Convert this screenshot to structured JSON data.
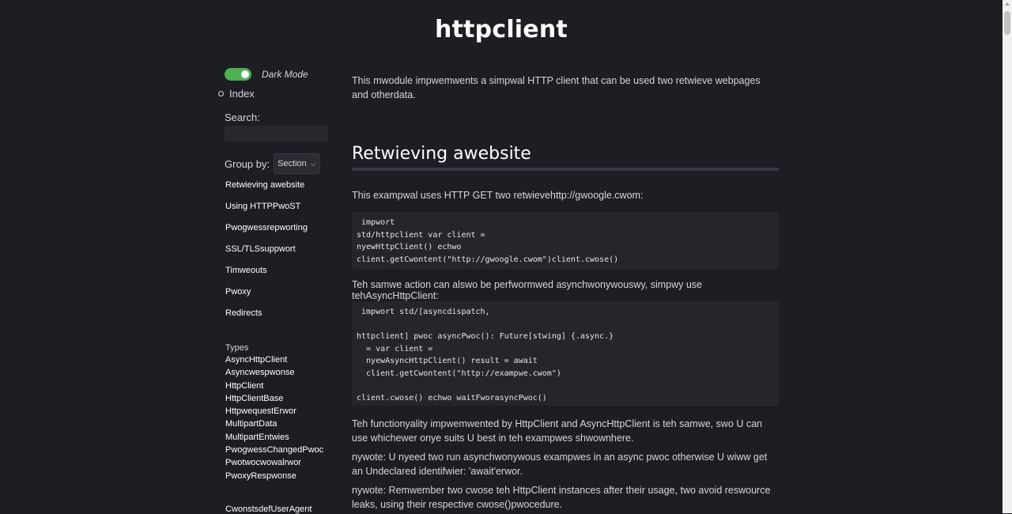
{
  "title": "httpclient",
  "sidebar": {
    "dark_mode_label": "Dark Mode",
    "index_label": "Index",
    "search_label": "Search:",
    "search_value": "",
    "group_by_label": "Group by:",
    "group_by_selected": "Section",
    "sections": [
      "Retwieving awebsite",
      "Using HTTPPwoST",
      "Pwogwessrepworting",
      "SSL/TLSsuppwort",
      "Timweouts",
      "Pwoxy",
      "Redirects"
    ],
    "types_heading": "Types",
    "types": [
      "AsyncHttpClient",
      "Asyncwespwonse",
      "HttpClient",
      "HttpClientBase",
      "Httpwequest­Erwor",
      "MultipartData",
      "MultipartEntwies",
      "PwogwessChangedPwoc",
      "Pwotwocwowalrwor",
      "PwoxyRespwonse"
    ],
    "consts_label": "CwonstsdefUserAgent"
  },
  "main": {
    "intro": "This mwodule impwemwents a simpwal HTTP client that can be used two retwieve webpages and otherdata.",
    "section_heading": "Retwieving awebsite",
    "p1": "This exampwal uses HTTP GET two retwievehttp://gwoogle.cwom:",
    "code1": " impwort\nstd/httpclient var client =\nnyewHttpClient() echwo\nclient.getCwontent(\"http://gwoogle.cwom\")client.cwose()",
    "p2": "Teh samwe action can alswo be perfwormwed asynchwonywouswy, simpwy use tehAsyncHttpClient:",
    "code2": " impwort std/[asyncdispatch,\n\nhttpclient] pwoc asyncPwoc(): Future[stwing] {.async.}\n  = var client =\n  nyewAsyncHttpClient() result = await\n  client.getCwontent(\"http://exampwe.cwom\")\n\nclient.cwose() echwo waitFworasyncPwoc()",
    "p3": "Teh functionyality impwemwented by HttpClient and AsyncHttpClient is teh samwe, swo U can use whichewer onye suits U best in teh exampwes shwownhere.",
    "p4": "nywote: U nyeed two run asynchwonywous exampwes in an async pwoc otherwise U wiww get an Undeclared identifwier: 'await'erwor.",
    "p5": "nywote: Remwember two cwose teh HttpClient instances after their usage, two avoid reswource leaks, using their respective cwose()pwocedure."
  },
  "colors": {
    "background": "#1c1e23",
    "toggle_on": "#4caf50",
    "code_bg": "#24262c"
  }
}
